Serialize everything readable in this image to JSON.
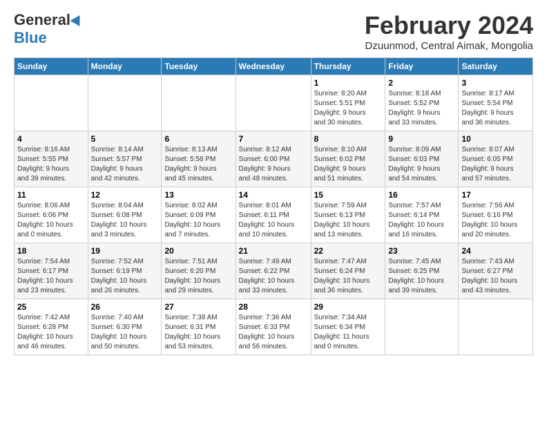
{
  "logo": {
    "general": "General",
    "blue": "Blue"
  },
  "header": {
    "month_year": "February 2024",
    "location": "Dzuunmod, Central Aimak, Mongolia"
  },
  "weekdays": [
    "Sunday",
    "Monday",
    "Tuesday",
    "Wednesday",
    "Thursday",
    "Friday",
    "Saturday"
  ],
  "weeks": [
    {
      "days": [
        {
          "number": "",
          "info": ""
        },
        {
          "number": "",
          "info": ""
        },
        {
          "number": "",
          "info": ""
        },
        {
          "number": "",
          "info": ""
        },
        {
          "number": "1",
          "info": "Sunrise: 8:20 AM\nSunset: 5:51 PM\nDaylight: 9 hours\nand 30 minutes."
        },
        {
          "number": "2",
          "info": "Sunrise: 8:18 AM\nSunset: 5:52 PM\nDaylight: 9 hours\nand 33 minutes."
        },
        {
          "number": "3",
          "info": "Sunrise: 8:17 AM\nSunset: 5:54 PM\nDaylight: 9 hours\nand 36 minutes."
        }
      ]
    },
    {
      "days": [
        {
          "number": "4",
          "info": "Sunrise: 8:16 AM\nSunset: 5:55 PM\nDaylight: 9 hours\nand 39 minutes."
        },
        {
          "number": "5",
          "info": "Sunrise: 8:14 AM\nSunset: 5:57 PM\nDaylight: 9 hours\nand 42 minutes."
        },
        {
          "number": "6",
          "info": "Sunrise: 8:13 AM\nSunset: 5:58 PM\nDaylight: 9 hours\nand 45 minutes."
        },
        {
          "number": "7",
          "info": "Sunrise: 8:12 AM\nSunset: 6:00 PM\nDaylight: 9 hours\nand 48 minutes."
        },
        {
          "number": "8",
          "info": "Sunrise: 8:10 AM\nSunset: 6:02 PM\nDaylight: 9 hours\nand 51 minutes."
        },
        {
          "number": "9",
          "info": "Sunrise: 8:09 AM\nSunset: 6:03 PM\nDaylight: 9 hours\nand 54 minutes."
        },
        {
          "number": "10",
          "info": "Sunrise: 8:07 AM\nSunset: 6:05 PM\nDaylight: 9 hours\nand 57 minutes."
        }
      ]
    },
    {
      "days": [
        {
          "number": "11",
          "info": "Sunrise: 8:06 AM\nSunset: 6:06 PM\nDaylight: 10 hours\nand 0 minutes."
        },
        {
          "number": "12",
          "info": "Sunrise: 8:04 AM\nSunset: 6:08 PM\nDaylight: 10 hours\nand 3 minutes."
        },
        {
          "number": "13",
          "info": "Sunrise: 8:02 AM\nSunset: 6:09 PM\nDaylight: 10 hours\nand 7 minutes."
        },
        {
          "number": "14",
          "info": "Sunrise: 8:01 AM\nSunset: 6:11 PM\nDaylight: 10 hours\nand 10 minutes."
        },
        {
          "number": "15",
          "info": "Sunrise: 7:59 AM\nSunset: 6:13 PM\nDaylight: 10 hours\nand 13 minutes."
        },
        {
          "number": "16",
          "info": "Sunrise: 7:57 AM\nSunset: 6:14 PM\nDaylight: 10 hours\nand 16 minutes."
        },
        {
          "number": "17",
          "info": "Sunrise: 7:56 AM\nSunset: 6:16 PM\nDaylight: 10 hours\nand 20 minutes."
        }
      ]
    },
    {
      "days": [
        {
          "number": "18",
          "info": "Sunrise: 7:54 AM\nSunset: 6:17 PM\nDaylight: 10 hours\nand 23 minutes."
        },
        {
          "number": "19",
          "info": "Sunrise: 7:52 AM\nSunset: 6:19 PM\nDaylight: 10 hours\nand 26 minutes."
        },
        {
          "number": "20",
          "info": "Sunrise: 7:51 AM\nSunset: 6:20 PM\nDaylight: 10 hours\nand 29 minutes."
        },
        {
          "number": "21",
          "info": "Sunrise: 7:49 AM\nSunset: 6:22 PM\nDaylight: 10 hours\nand 33 minutes."
        },
        {
          "number": "22",
          "info": "Sunrise: 7:47 AM\nSunset: 6:24 PM\nDaylight: 10 hours\nand 36 minutes."
        },
        {
          "number": "23",
          "info": "Sunrise: 7:45 AM\nSunset: 6:25 PM\nDaylight: 10 hours\nand 39 minutes."
        },
        {
          "number": "24",
          "info": "Sunrise: 7:43 AM\nSunset: 6:27 PM\nDaylight: 10 hours\nand 43 minutes."
        }
      ]
    },
    {
      "days": [
        {
          "number": "25",
          "info": "Sunrise: 7:42 AM\nSunset: 6:28 PM\nDaylight: 10 hours\nand 46 minutes."
        },
        {
          "number": "26",
          "info": "Sunrise: 7:40 AM\nSunset: 6:30 PM\nDaylight: 10 hours\nand 50 minutes."
        },
        {
          "number": "27",
          "info": "Sunrise: 7:38 AM\nSunset: 6:31 PM\nDaylight: 10 hours\nand 53 minutes."
        },
        {
          "number": "28",
          "info": "Sunrise: 7:36 AM\nSunset: 6:33 PM\nDaylight: 10 hours\nand 56 minutes."
        },
        {
          "number": "29",
          "info": "Sunrise: 7:34 AM\nSunset: 6:34 PM\nDaylight: 11 hours\nand 0 minutes."
        },
        {
          "number": "",
          "info": ""
        },
        {
          "number": "",
          "info": ""
        }
      ]
    }
  ]
}
